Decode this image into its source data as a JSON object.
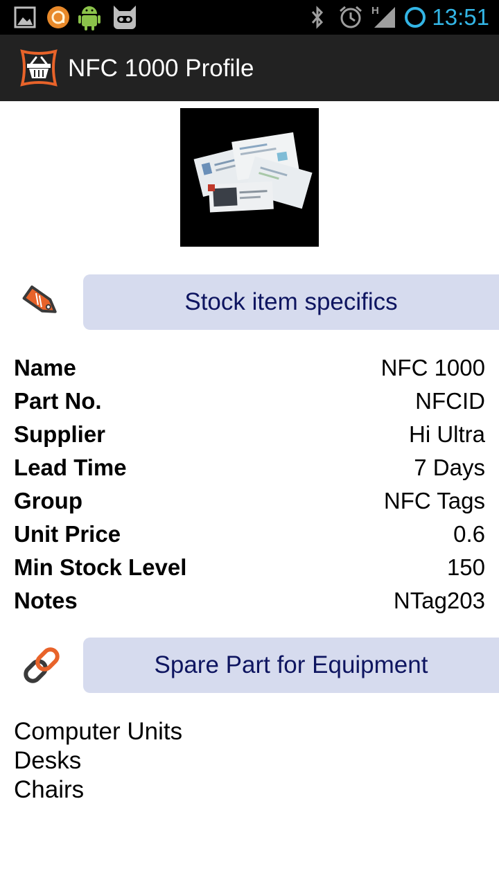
{
  "status_bar": {
    "time": "13:51",
    "network_type": "H",
    "icons": [
      "gallery-icon",
      "avast-icon",
      "android-icon",
      "cyanogenmod-icon",
      "bluetooth-icon",
      "alarm-icon",
      "signal-icon",
      "sync-ring-icon"
    ],
    "clock_color": "#33b5e5"
  },
  "action_bar": {
    "title": "NFC 1000 Profile",
    "icon": "basket-icon",
    "accent": "#e8632a"
  },
  "stock_section": {
    "header": "Stock item specifics",
    "icon": "tag-icon",
    "rows": [
      {
        "label": "Name",
        "value": "NFC 1000"
      },
      {
        "label": "Part No.",
        "value": "NFCID"
      },
      {
        "label": "Supplier",
        "value": "Hi Ultra"
      },
      {
        "label": "Lead Time",
        "value": "7 Days"
      },
      {
        "label": "Group",
        "value": "NFC Tags"
      },
      {
        "label": "Unit Price",
        "value": "0.6"
      },
      {
        "label": "Min Stock Level",
        "value": "150"
      },
      {
        "label": "Notes",
        "value": "NTag203"
      }
    ]
  },
  "equipment_section": {
    "header": "Spare Part for Equipment",
    "icon": "link-icon",
    "items": [
      "Computer Units",
      "Desks",
      "Chairs"
    ]
  },
  "colors": {
    "section_button_bg": "#d6dbee",
    "section_button_text": "#0e1560"
  }
}
